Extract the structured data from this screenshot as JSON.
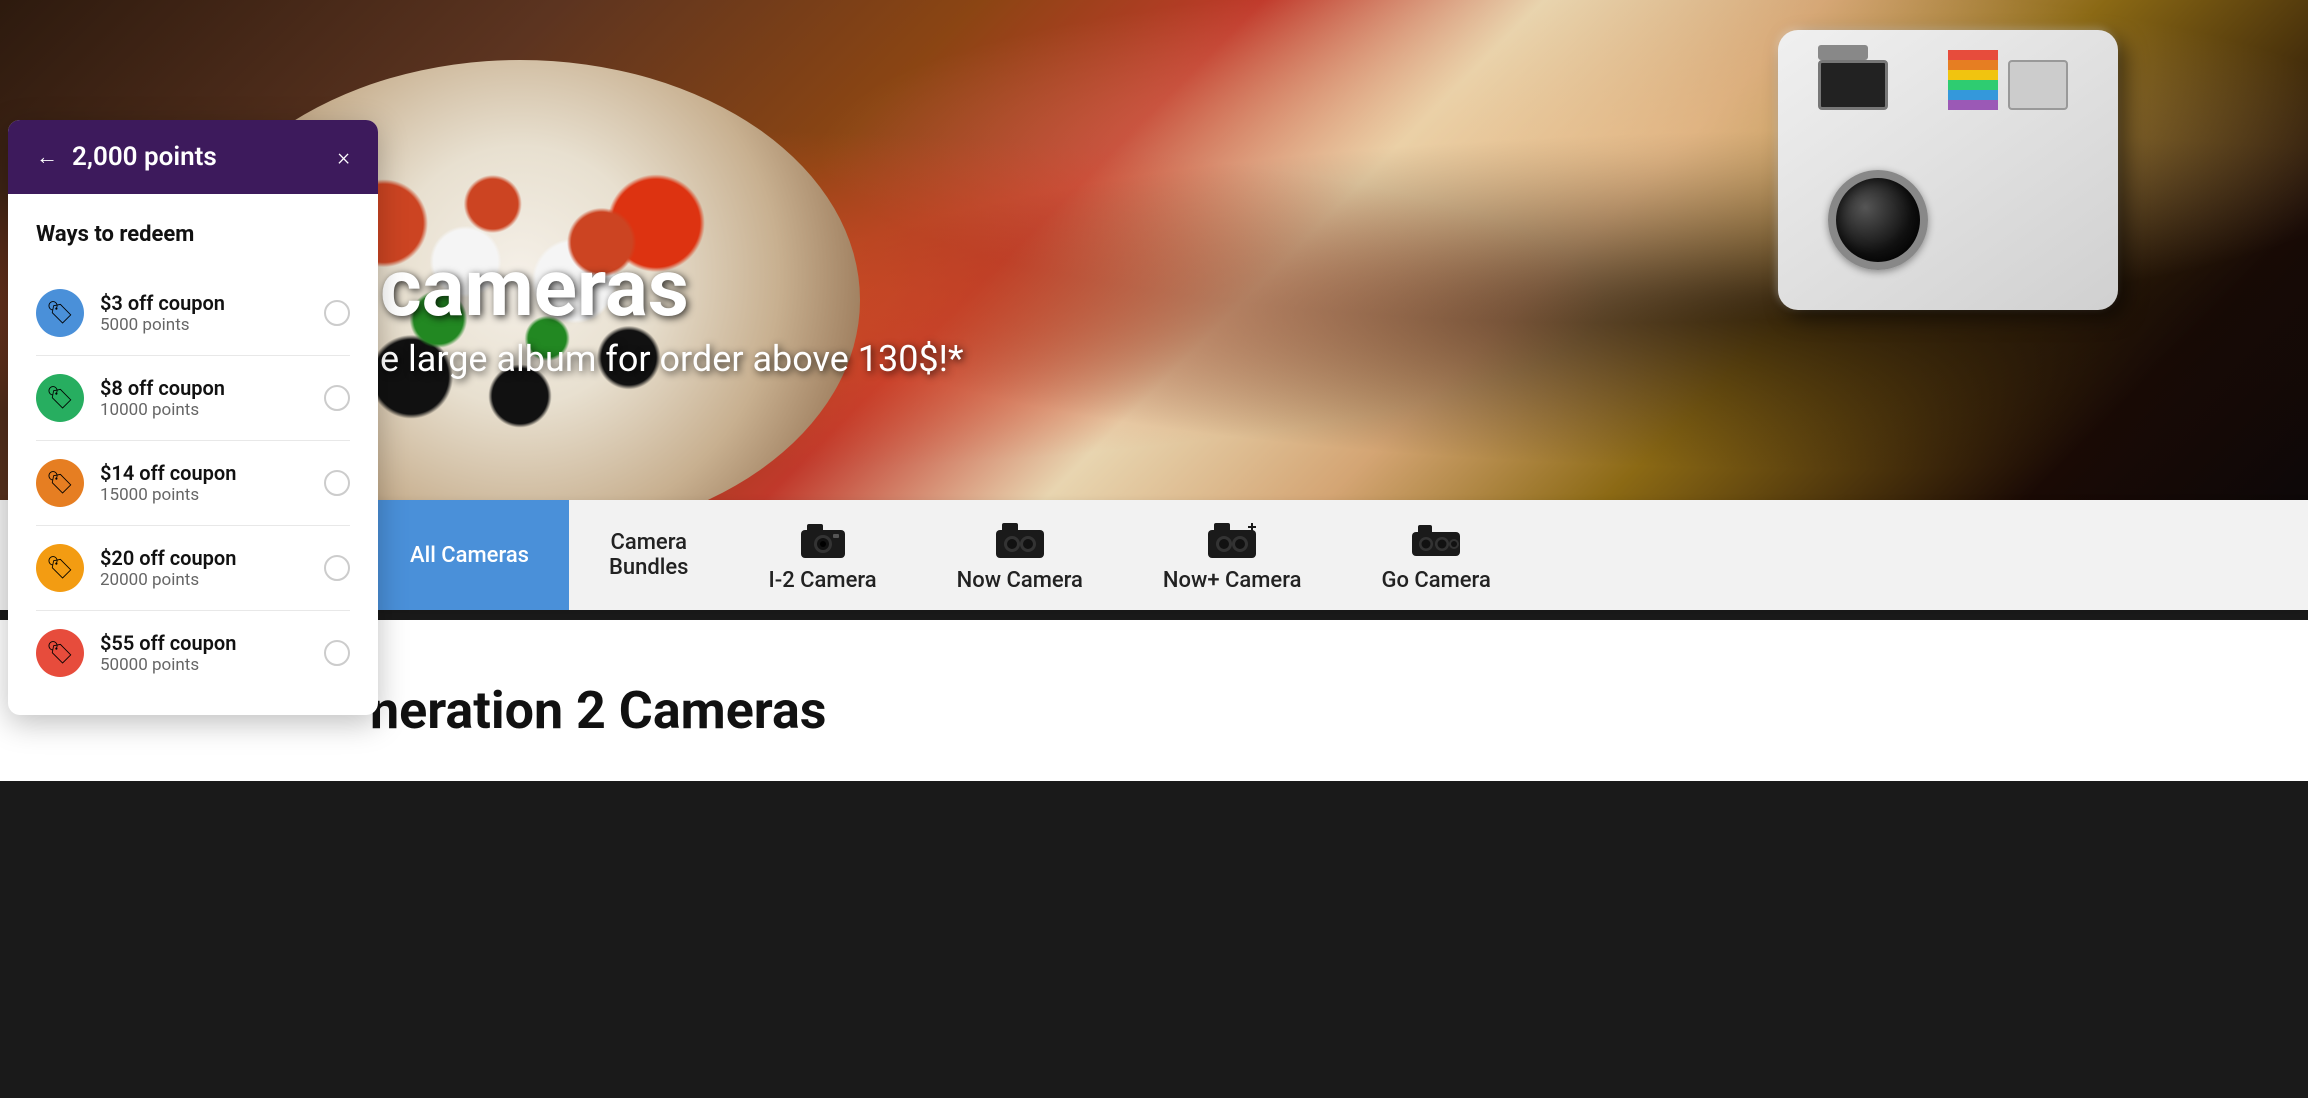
{
  "hero": {
    "title": "cameras",
    "subtitle": "e large album for order above 130$!*"
  },
  "rewards_panel": {
    "points": "2,000 points",
    "ways_to_redeem": "Ways to redeem",
    "back_label": "←",
    "close_label": "×",
    "coupons": [
      {
        "id": "coupon-3",
        "amount": "$3 off coupon",
        "points": "5000 points",
        "color": "blue",
        "icon": "🏷"
      },
      {
        "id": "coupon-8",
        "amount": "$8 off coupon",
        "points": "10000 points",
        "color": "green",
        "icon": "🏷"
      },
      {
        "id": "coupon-14",
        "amount": "$14 off coupon",
        "points": "15000 points",
        "color": "orange",
        "icon": "🏷"
      },
      {
        "id": "coupon-20",
        "amount": "$20 off coupon",
        "points": "20000 points",
        "color": "gold",
        "icon": "🏷"
      },
      {
        "id": "coupon-55",
        "amount": "$55 off coupon",
        "points": "50000 points",
        "color": "red",
        "icon": "🏷"
      }
    ]
  },
  "nav": {
    "items": [
      {
        "id": "all-cameras",
        "label": "All Cameras",
        "active": true,
        "has_icon": false
      },
      {
        "id": "camera-bundles",
        "label": "Camera\nBundles",
        "active": false,
        "has_icon": false
      },
      {
        "id": "i2-camera",
        "label": "I-2 Camera",
        "active": false,
        "has_icon": true
      },
      {
        "id": "now-camera",
        "label": "Now Camera",
        "active": false,
        "has_icon": true
      },
      {
        "id": "nowplus-camera",
        "label": "Now+ Camera",
        "active": false,
        "has_icon": true
      },
      {
        "id": "go-camera",
        "label": "Go Camera",
        "active": false,
        "has_icon": true
      }
    ]
  },
  "section": {
    "title": "neration 2 Cameras"
  },
  "colors": {
    "accent_blue": "#4a90d9",
    "header_purple": "#3d1a5c",
    "nav_bg": "#f2f2f2"
  }
}
